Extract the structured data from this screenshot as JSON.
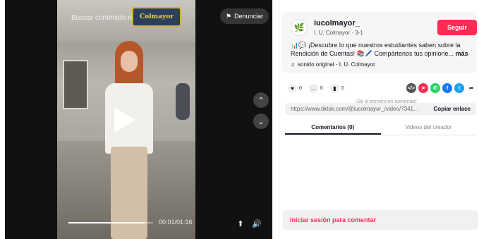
{
  "video": {
    "search_placeholder": "Buscar contenido relacionado",
    "report_label": "Denunciar",
    "progress": 0.9,
    "time": "00:01/01:16"
  },
  "author": {
    "username": "iucolmayor_",
    "display": "I. U. Colmayor · 3-1",
    "follow_label": "Seguir",
    "description": "📊💬 ¡Descubre lo que nuestros estudiantes saben sobre la Rendición de Cuentas! 📚🖊️ Compártenos tus opinione...",
    "more_label": "más",
    "sound": "sonido original - I. U. Colmayor"
  },
  "stats": {
    "likes": "0",
    "comments": "0",
    "saves": "0"
  },
  "link": {
    "hint": "¡Sé el primero en comentar!",
    "url": "https://www.tiktok.com/@iucolmayor_/video/7341...",
    "copy_label": "Copiar enlace"
  },
  "tabs": [
    {
      "label": "Comentarios (0)"
    },
    {
      "label": "Videos del creador"
    }
  ],
  "comment_prompt": "Iniciar sesión para comentar",
  "colors": {
    "accent": "#fe2c55"
  }
}
